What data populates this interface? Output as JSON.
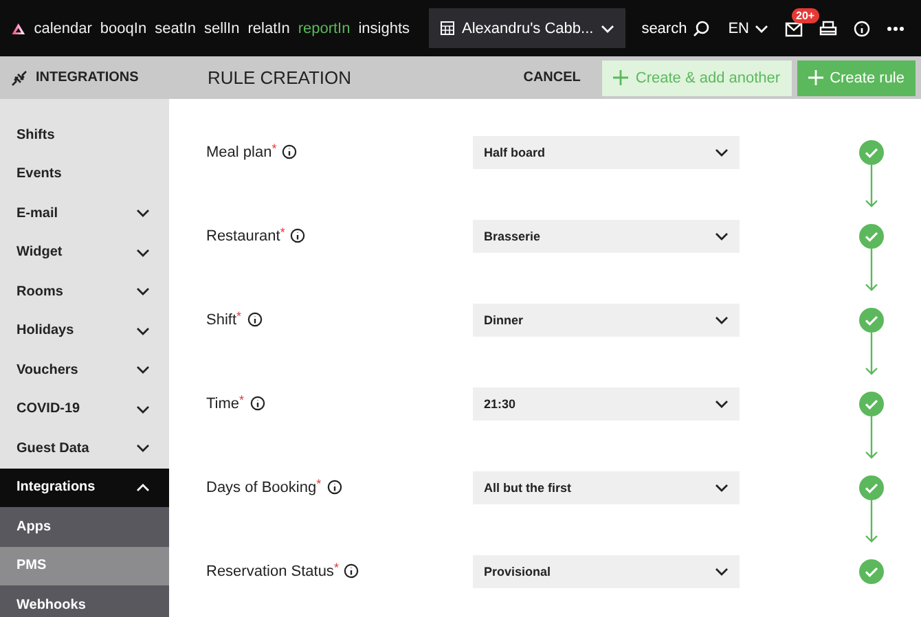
{
  "nav": {
    "items": [
      {
        "label": "calendar",
        "selected": false
      },
      {
        "label": "booqIn",
        "selected": false
      },
      {
        "label": "seatIn",
        "selected": false
      },
      {
        "label": "sellIn",
        "selected": false
      },
      {
        "label": "relatIn",
        "selected": false
      },
      {
        "label": "reportIn",
        "selected": true
      },
      {
        "label": "insights",
        "selected": false
      }
    ],
    "venue": "Alexandru's Cabb...",
    "search": "search",
    "language": "EN",
    "mail_badge": "20+"
  },
  "sidebar": {
    "title": "INTEGRATIONS",
    "items": [
      {
        "label": "Shifts",
        "kind": "link"
      },
      {
        "label": "Events",
        "kind": "link"
      },
      {
        "label": "E-mail",
        "kind": "group",
        "expanded": false
      },
      {
        "label": "Widget",
        "kind": "group",
        "expanded": false
      },
      {
        "label": "Rooms",
        "kind": "group",
        "expanded": false
      },
      {
        "label": "Holidays",
        "kind": "group",
        "expanded": false
      },
      {
        "label": "Vouchers",
        "kind": "group",
        "expanded": false
      },
      {
        "label": "COVID-19",
        "kind": "group",
        "expanded": false
      },
      {
        "label": "Guest Data",
        "kind": "group",
        "expanded": false
      },
      {
        "label": "Integrations",
        "kind": "group",
        "expanded": true,
        "children": [
          {
            "label": "Apps",
            "selected": false
          },
          {
            "label": "PMS",
            "selected": true
          },
          {
            "label": "Webhooks",
            "selected": false
          }
        ]
      }
    ]
  },
  "header": {
    "title": "RULE CREATION",
    "cancel": "CANCEL",
    "secondary": "Create & add another",
    "primary": "Create rule"
  },
  "fields": [
    {
      "label": "Meal plan",
      "required_mark": "*",
      "value": "Half board",
      "complete": true
    },
    {
      "label": "Restaurant",
      "required_mark": "*",
      "value": "Brasserie",
      "complete": true
    },
    {
      "label": "Shift",
      "required_mark": "*",
      "value": "Dinner",
      "complete": true
    },
    {
      "label": "Time",
      "required_mark": "*",
      "value": "21:30",
      "complete": true
    },
    {
      "label": "Days of Booking",
      "required_mark": "*",
      "value": "All but the first",
      "complete": true
    },
    {
      "label": "Reservation Status",
      "required_mark": "*",
      "value": "Provisional",
      "complete": true
    }
  ]
}
